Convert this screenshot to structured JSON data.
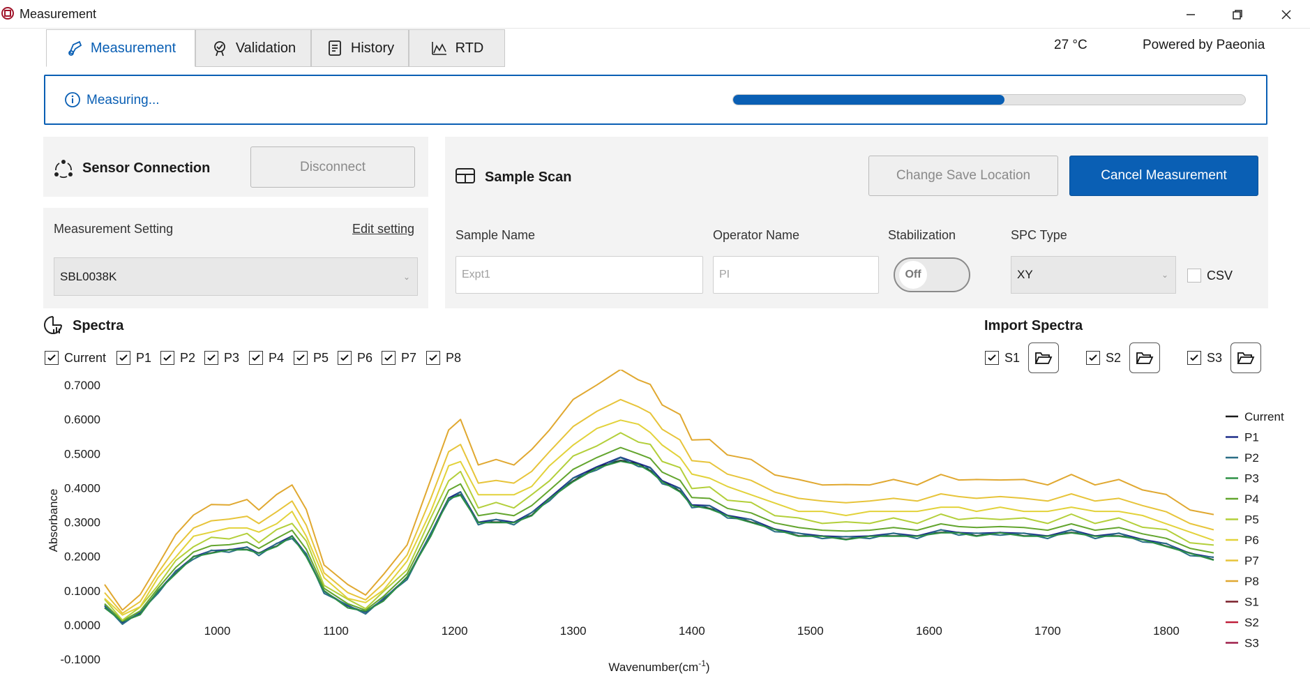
{
  "window": {
    "title": "Measurement"
  },
  "tabs": [
    {
      "label": "Measurement",
      "icon": "measurement-flask-icon",
      "active": true
    },
    {
      "label": "Validation",
      "icon": "validation-icon",
      "active": false
    },
    {
      "label": "History",
      "icon": "history-icon",
      "active": false
    },
    {
      "label": "RTD",
      "icon": "rtd-chart-icon",
      "active": false
    }
  ],
  "header": {
    "temperature": "27 °C",
    "powered_by": "Powered by Paeonia"
  },
  "status": {
    "text": "Measuring...",
    "progress": 0.53
  },
  "sensor": {
    "title": "Sensor Connection",
    "disconnect_label": "Disconnect"
  },
  "measurement_setting": {
    "label": "Measurement Setting",
    "edit_label": "Edit setting",
    "selected": "SBL0038K"
  },
  "sample_scan": {
    "title": "Sample Scan",
    "change_save_label": "Change Save Location",
    "cancel_label": "Cancel Measurement",
    "sample_name_label": "Sample Name",
    "sample_name_value": "Expt1",
    "operator_name_label": "Operator Name",
    "operator_name_value": "PI",
    "stabilization_label": "Stabilization",
    "stabilization_value": "Off",
    "spc_type_label": "SPC Type",
    "spc_type_value": "XY",
    "csv_label": "CSV",
    "csv_checked": false
  },
  "spectra": {
    "title": "Spectra",
    "checkboxes": [
      {
        "label": "Current",
        "checked": true
      },
      {
        "label": "P1",
        "checked": true
      },
      {
        "label": "P2",
        "checked": true
      },
      {
        "label": "P3",
        "checked": true
      },
      {
        "label": "P4",
        "checked": true
      },
      {
        "label": "P5",
        "checked": true
      },
      {
        "label": "P6",
        "checked": true
      },
      {
        "label": "P7",
        "checked": true
      },
      {
        "label": "P8",
        "checked": true
      }
    ]
  },
  "import_spectra": {
    "title": "Import Spectra",
    "items": [
      {
        "label": "S1",
        "checked": true
      },
      {
        "label": "S2",
        "checked": true
      },
      {
        "label": "S3",
        "checked": true
      }
    ]
  },
  "colors": {
    "accent": "#0a5fb4",
    "panel": "#f3f3f3"
  },
  "chart_data": {
    "type": "line",
    "xlabel": "Wavenumber(cm",
    "xlabel_sup": "-1",
    "xlabel_close": ")",
    "ylabel": "Absorbance",
    "xlim": [
      905,
      1840
    ],
    "ylim": [
      -0.1,
      0.7
    ],
    "x_ticks": [
      "1000",
      "1100",
      "1200",
      "1300",
      "1400",
      "1500",
      "1600",
      "1700",
      "1800"
    ],
    "y_ticks": [
      "0.7000",
      "0.6000",
      "0.5000",
      "0.4000",
      "0.3000",
      "0.2000",
      "0.1000",
      "0.0000",
      "-0.1000"
    ],
    "legend_position": "right",
    "x": [
      905,
      920,
      935,
      950,
      965,
      980,
      995,
      1010,
      1025,
      1035,
      1050,
      1063,
      1075,
      1090,
      1110,
      1125,
      1140,
      1160,
      1180,
      1195,
      1205,
      1220,
      1235,
      1250,
      1265,
      1280,
      1300,
      1320,
      1340,
      1355,
      1365,
      1375,
      1390,
      1400,
      1415,
      1430,
      1450,
      1470,
      1490,
      1510,
      1530,
      1550,
      1570,
      1590,
      1610,
      1625,
      1640,
      1660,
      1680,
      1700,
      1720,
      1740,
      1760,
      1780,
      1800,
      1820,
      1840
    ],
    "base": [
      0.05,
      0.01,
      0.03,
      0.1,
      0.15,
      0.2,
      0.21,
      0.22,
      0.22,
      0.21,
      0.23,
      0.26,
      0.2,
      0.1,
      0.05,
      0.04,
      0.07,
      0.14,
      0.26,
      0.37,
      0.38,
      0.3,
      0.3,
      0.3,
      0.32,
      0.37,
      0.42,
      0.46,
      0.48,
      0.47,
      0.45,
      0.42,
      0.39,
      0.35,
      0.34,
      0.32,
      0.3,
      0.28,
      0.26,
      0.26,
      0.25,
      0.26,
      0.26,
      0.26,
      0.27,
      0.27,
      0.26,
      0.27,
      0.26,
      0.26,
      0.27,
      0.26,
      0.26,
      0.25,
      0.23,
      0.21,
      0.19
    ],
    "series": [
      {
        "name": "Current",
        "color": "#1a1a1a",
        "bump": 0.0
      },
      {
        "name": "P1",
        "color": "#1f2e8a",
        "bump": 0.01
      },
      {
        "name": "P2",
        "color": "#2a6e86",
        "bump": 0.0
      },
      {
        "name": "P3",
        "color": "#2e9146",
        "bump": -0.005
      },
      {
        "name": "P4",
        "color": "#63a52e",
        "bump": 0.06
      },
      {
        "name": "P5",
        "color": "#b3cf3a",
        "bump": 0.13
      },
      {
        "name": "P6",
        "color": "#e2d23a",
        "bump": 0.21
      },
      {
        "name": "P7",
        "color": "#e7c43a",
        "bump": 0.31
      },
      {
        "name": "P8",
        "color": "#e0a830",
        "bump": 0.46
      },
      {
        "name": "S1",
        "color": "#7a1e2a",
        "bump": null
      },
      {
        "name": "S2",
        "color": "#c0203a",
        "bump": null
      },
      {
        "name": "S3",
        "color": "#9e1f4a",
        "bump": null
      }
    ]
  }
}
